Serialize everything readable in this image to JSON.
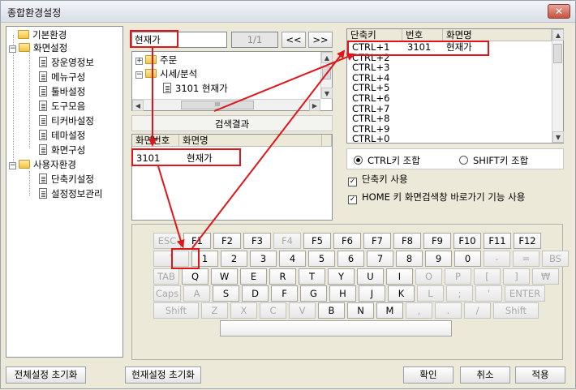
{
  "window": {
    "title": "종합환경설정",
    "close_label": "✕"
  },
  "tree": {
    "items": [
      {
        "label": "기본환경"
      },
      {
        "label": "화면설정"
      },
      {
        "label": "장운영정보"
      },
      {
        "label": "메뉴구성"
      },
      {
        "label": "툴바설정"
      },
      {
        "label": "도구모음"
      },
      {
        "label": "티커바설정"
      },
      {
        "label": "테마설정"
      },
      {
        "label": "화면구성"
      },
      {
        "label": "사용자환경"
      },
      {
        "label": "단축키설정"
      },
      {
        "label": "설정정보관리"
      }
    ],
    "expander_minus": "−"
  },
  "search": {
    "value": "현재가",
    "page": "1/1",
    "prev_label": "<<",
    "next_label": ">>",
    "menu_items": [
      {
        "label": "주문"
      },
      {
        "label": "시세/분석"
      },
      {
        "label": "3101 현재가"
      }
    ],
    "scroll_mid": "III",
    "result_title": "검색결과",
    "result_headers": [
      "화면번호",
      "화면명"
    ],
    "result_rows": [
      {
        "num": "3101",
        "name": "현재가"
      }
    ]
  },
  "shortcuts": {
    "headers": [
      "단축키",
      "번호",
      "화면명"
    ],
    "rows": [
      {
        "key": "CTRL+1",
        "num": "3101",
        "name": "현재가"
      },
      {
        "key": "CTRL+2",
        "num": "",
        "name": ""
      },
      {
        "key": "CTRL+3",
        "num": "",
        "name": ""
      },
      {
        "key": "CTRL+4",
        "num": "",
        "name": ""
      },
      {
        "key": "CTRL+5",
        "num": "",
        "name": ""
      },
      {
        "key": "CTRL+6",
        "num": "",
        "name": ""
      },
      {
        "key": "CTRL+7",
        "num": "",
        "name": ""
      },
      {
        "key": "CTRL+8",
        "num": "",
        "name": ""
      },
      {
        "key": "CTRL+9",
        "num": "",
        "name": ""
      },
      {
        "key": "CTRL+0",
        "num": "",
        "name": ""
      }
    ]
  },
  "options": {
    "ctrl_combo": "CTRL키 조합",
    "shift_combo": "SHIFT키 조합",
    "use_shortcut": "단축키 사용",
    "home_key": "HOME 키 화면검색창 바로가기 기능 사용",
    "check_mark": "✓"
  },
  "keyboard": {
    "row1": [
      "ESC",
      "F1",
      "F2",
      "F3",
      "F4",
      "F5",
      "F6",
      "F7",
      "F8",
      "F9",
      "F10",
      "F11",
      "F12"
    ],
    "row2": [
      "`",
      "1",
      "2",
      "3",
      "4",
      "5",
      "6",
      "7",
      "8",
      "9",
      "0",
      "-",
      "=",
      "BS"
    ],
    "row3": [
      "TAB",
      "Q",
      "W",
      "E",
      "R",
      "T",
      "Y",
      "U",
      "I",
      "O",
      "P",
      "[",
      "]",
      "₩"
    ],
    "row4": [
      "Caps",
      "A",
      "S",
      "D",
      "F",
      "G",
      "H",
      "J",
      "K",
      "L",
      ";",
      "'",
      "ENTER"
    ],
    "row5": [
      "Shift",
      "Z",
      "X",
      "C",
      "V",
      "B",
      "N",
      "M",
      ",",
      ".",
      "/",
      "Shift"
    ]
  },
  "footer": {
    "reset_all": "전체설정 초기화",
    "reset_current": "현재설정 초기화",
    "ok": "확인",
    "cancel": "취소",
    "apply": "적용"
  }
}
